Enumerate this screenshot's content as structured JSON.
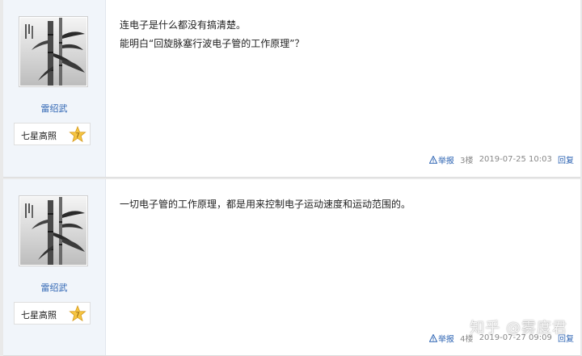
{
  "posts": [
    {
      "username": "雷绍武",
      "badge_label": "七星高照",
      "badge_level": "7",
      "lines": [
        "连电子是什么都没有搞清楚。",
        "能明白“回旋脉塞行波电子管的工作原理”？"
      ],
      "report_label": "举报",
      "floor": "3楼",
      "timestamp": "2019-07-25 10:03",
      "reply_label": "回复"
    },
    {
      "username": "雷绍武",
      "badge_label": "七星高照",
      "badge_level": "7",
      "lines": [
        "一切电子管的工作原理，都是用来控制电子运动速度和运动范围的。"
      ],
      "report_label": "举报",
      "floor": "4楼",
      "timestamp": "2019-07-27 09:09",
      "reply_label": "回复"
    }
  ],
  "watermark": "知乎 @雾度君",
  "colors": {
    "link": "#2d64b3",
    "sidebar_bg": "#f1f5fa",
    "badge_star": "#f5c542"
  },
  "icons": {
    "report": "warning-triangle-icon",
    "badge": "level-star-icon",
    "avatar": "bamboo-ink-painting"
  }
}
